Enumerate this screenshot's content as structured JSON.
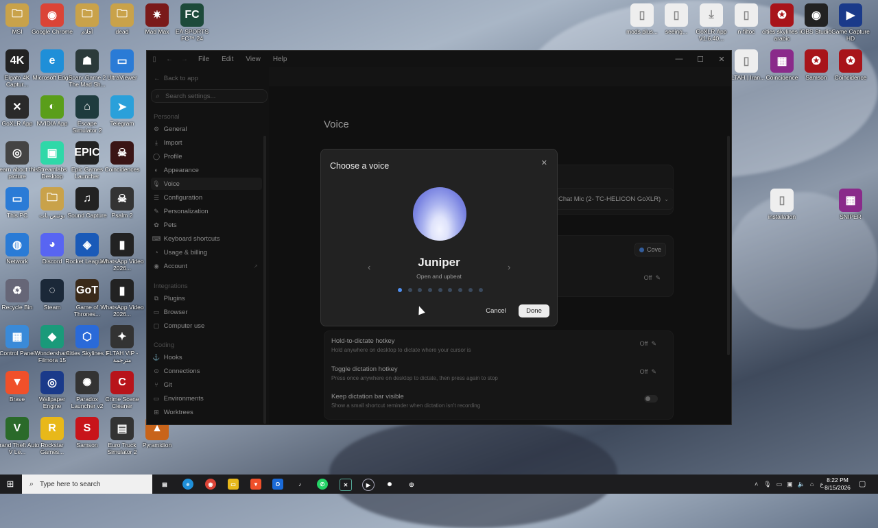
{
  "desktop": {
    "icons": [
      {
        "label": "MSI",
        "color": "#c9a24a",
        "glyph": "🗀"
      },
      {
        "label": "Google Chrome",
        "color": "#db4437",
        "glyph": "◉"
      },
      {
        "label": "أفلام",
        "color": "#c9a24a",
        "glyph": "🗀"
      },
      {
        "label": "dead",
        "color": "#c9a24a",
        "glyph": "🗀"
      },
      {
        "label": "Mad Max",
        "color": "#7a1a1a",
        "glyph": "✷"
      },
      {
        "label": "EA SPORTS FC™ 24",
        "color": "#1d4a3a",
        "glyph": "FC"
      },
      {
        "label": "Elgato 4K Captur...",
        "color": "#222",
        "glyph": "4K"
      },
      {
        "label": "Microsoft Edge",
        "color": "#1f8fd8",
        "glyph": "e"
      },
      {
        "label": "Scary Game 2 The Mad Sh...",
        "color": "#2b3a3a",
        "glyph": "☗"
      },
      {
        "label": "UltraViewer",
        "color": "#2a7bd6",
        "glyph": "▭"
      },
      {
        "label": "GoXLR App",
        "color": "#2a2a2a",
        "glyph": "✕"
      },
      {
        "label": "NVIDIA App",
        "color": "#5a9e1a",
        "glyph": "◐"
      },
      {
        "label": "Escape Simulator 2",
        "color": "#1e3b3e",
        "glyph": "⌂"
      },
      {
        "label": "Telegram",
        "color": "#2aa0da",
        "glyph": "➤"
      },
      {
        "label": "Learn about this picture",
        "color": "#444",
        "glyph": "◎"
      },
      {
        "label": "Streamlabs Desktop",
        "color": "#2fd8a8",
        "glyph": "▣"
      },
      {
        "label": "Epic Games Launcher",
        "color": "#222",
        "glyph": "EPIC"
      },
      {
        "label": "Coincidences",
        "color": "#3a1515",
        "glyph": "☠"
      },
      {
        "label": "This PC",
        "color": "#2a7bd6",
        "glyph": "▭"
      },
      {
        "label": "بوتيس بات",
        "color": "#c9a24a",
        "glyph": "🗀"
      },
      {
        "label": "Sound Capture",
        "color": "#222",
        "glyph": "♫"
      },
      {
        "label": "Psalm 2",
        "color": "#333",
        "glyph": "☠"
      },
      {
        "label": "Network",
        "color": "#2a7bd6",
        "glyph": "◍"
      },
      {
        "label": "Discord",
        "color": "#5865f2",
        "glyph": "◕"
      },
      {
        "label": "Rocket League®",
        "color": "#1a5ab8",
        "glyph": "◈"
      },
      {
        "label": "WhatsApp Video 2026...",
        "color": "#222",
        "glyph": "▮"
      },
      {
        "label": "Recycle Bin",
        "color": "#667",
        "glyph": "♻"
      },
      {
        "label": "Steam",
        "color": "#1b2838",
        "glyph": "◌"
      },
      {
        "label": "Game of Thrones...",
        "color": "#3a2a1a",
        "glyph": "GoT"
      },
      {
        "label": "WhatsApp Video 2026...",
        "color": "#222",
        "glyph": "▮"
      },
      {
        "label": "Control Panel",
        "color": "#3a8ad8",
        "glyph": "▦"
      },
      {
        "label": "Wondershare Filmora 15",
        "color": "#1a9a7a",
        "glyph": "◆"
      },
      {
        "label": "Cities Skylines II",
        "color": "#2a6ad8",
        "glyph": "⬡"
      },
      {
        "label": "FLTAH VIP - مترجمة",
        "color": "#333",
        "glyph": "✦"
      },
      {
        "label": "Brave",
        "color": "#f0502a",
        "glyph": "▼"
      },
      {
        "label": "Wallpaper Engine",
        "color": "#1a3a8a",
        "glyph": "◎"
      },
      {
        "label": "Paradox Launcher v2",
        "color": "#333",
        "glyph": "✺"
      },
      {
        "label": "Crime Scene Cleaner",
        "color": "#b8141a",
        "glyph": "C"
      },
      {
        "label": "Grand Theft Auto V Le...",
        "color": "#2a6a2a",
        "glyph": "V"
      },
      {
        "label": "Rockstar Games...",
        "color": "#e8b81a",
        "glyph": "R"
      },
      {
        "label": "Samson",
        "color": "#c8141a",
        "glyph": "S"
      },
      {
        "label": "Euro Truck Simulator 2",
        "color": "#333",
        "glyph": "▤"
      },
      {
        "label": "Pyramidion",
        "color": "#c8641a",
        "glyph": "▲"
      },
      {
        "label": "mods plus...",
        "color": "#eee",
        "glyph": "▯"
      },
      {
        "label": "seeing...",
        "color": "#eee",
        "glyph": "▯"
      },
      {
        "label": "GoXLR App V1.6.40...",
        "color": "#eee",
        "glyph": "⤓"
      },
      {
        "label": "n-filtoc",
        "color": "#eee",
        "glyph": "▯"
      },
      {
        "label": "cities skylines ii arabic",
        "color": "#a8141a",
        "glyph": "✪"
      },
      {
        "label": "OBS Studio",
        "color": "#222",
        "glyph": "◉"
      },
      {
        "label": "Game Capture HD",
        "color": "#1a3a8a",
        "glyph": "▶"
      },
      {
        "label": "FLTAH | Iran...",
        "color": "#eee",
        "glyph": "▯"
      },
      {
        "label": "Coincidence",
        "color": "#8a2a8a",
        "glyph": "▦"
      },
      {
        "label": "Samson",
        "color": "#a8141a",
        "glyph": "✪"
      },
      {
        "label": "Coincidence",
        "color": "#a8141a",
        "glyph": "✪"
      },
      {
        "label": "installation",
        "color": "#eee",
        "glyph": "▯"
      },
      {
        "label": "SNIPER",
        "color": "#8a2a8a",
        "glyph": "▦"
      }
    ]
  },
  "window": {
    "menu": [
      "File",
      "Edit",
      "View",
      "Help"
    ]
  },
  "sidebar": {
    "back": "Back to app",
    "search_placeholder": "Search settings...",
    "sections": {
      "personal": "Personal",
      "integrations": "Integrations",
      "coding": "Coding"
    },
    "personal_items": [
      {
        "label": "General",
        "icon": "⚙"
      },
      {
        "label": "Import",
        "icon": "⤓"
      },
      {
        "label": "Profile",
        "icon": "◯"
      },
      {
        "label": "Appearance",
        "icon": "◐"
      },
      {
        "label": "Voice",
        "icon": "🎙"
      },
      {
        "label": "Configuration",
        "icon": "☰"
      },
      {
        "label": "Personalization",
        "icon": "✎"
      },
      {
        "label": "Pets",
        "icon": "✿"
      },
      {
        "label": "Keyboard shortcuts",
        "icon": "⌨"
      },
      {
        "label": "Usage & billing",
        "icon": "◔"
      },
      {
        "label": "Account",
        "icon": "◉"
      }
    ],
    "integration_items": [
      {
        "label": "Plugins",
        "icon": "⧉"
      },
      {
        "label": "Browser",
        "icon": "▭"
      },
      {
        "label": "Computer use",
        "icon": "▢"
      }
    ],
    "coding_items": [
      {
        "label": "Hooks",
        "icon": "⚓"
      },
      {
        "label": "Connections",
        "icon": "⊙"
      },
      {
        "label": "Git",
        "icon": "⑂"
      },
      {
        "label": "Environments",
        "icon": "▭"
      },
      {
        "label": "Worktrees",
        "icon": "⊞"
      }
    ]
  },
  "main": {
    "title": "Voice",
    "mic_select": "Chat Mic (2- TC-HELICON GoXLR)",
    "voice_badge": "Cove",
    "off_label": "Off",
    "rows": [
      {
        "title": "Hold-to-dictate hotkey",
        "desc": "Hold anywhere on desktop to dictate where your cursor is",
        "value": "Off"
      },
      {
        "title": "Toggle dictation hotkey",
        "desc": "Press once anywhere on desktop to dictate, then press again to stop",
        "value": "Off"
      },
      {
        "title": "Keep dictation bar visible",
        "desc": "Show a small shortcut reminder when dictation isn't recording",
        "value": ""
      }
    ]
  },
  "dialog": {
    "title": "Choose a voice",
    "voice_name": "Juniper",
    "voice_desc": "Open and upbeat",
    "page_count": 9,
    "current_page": 1,
    "cancel": "Cancel",
    "done": "Done"
  },
  "taskbar": {
    "search_placeholder": "Type here to search",
    "time": "8:22 PM",
    "date": "8/15/2026",
    "lang": "ع"
  }
}
